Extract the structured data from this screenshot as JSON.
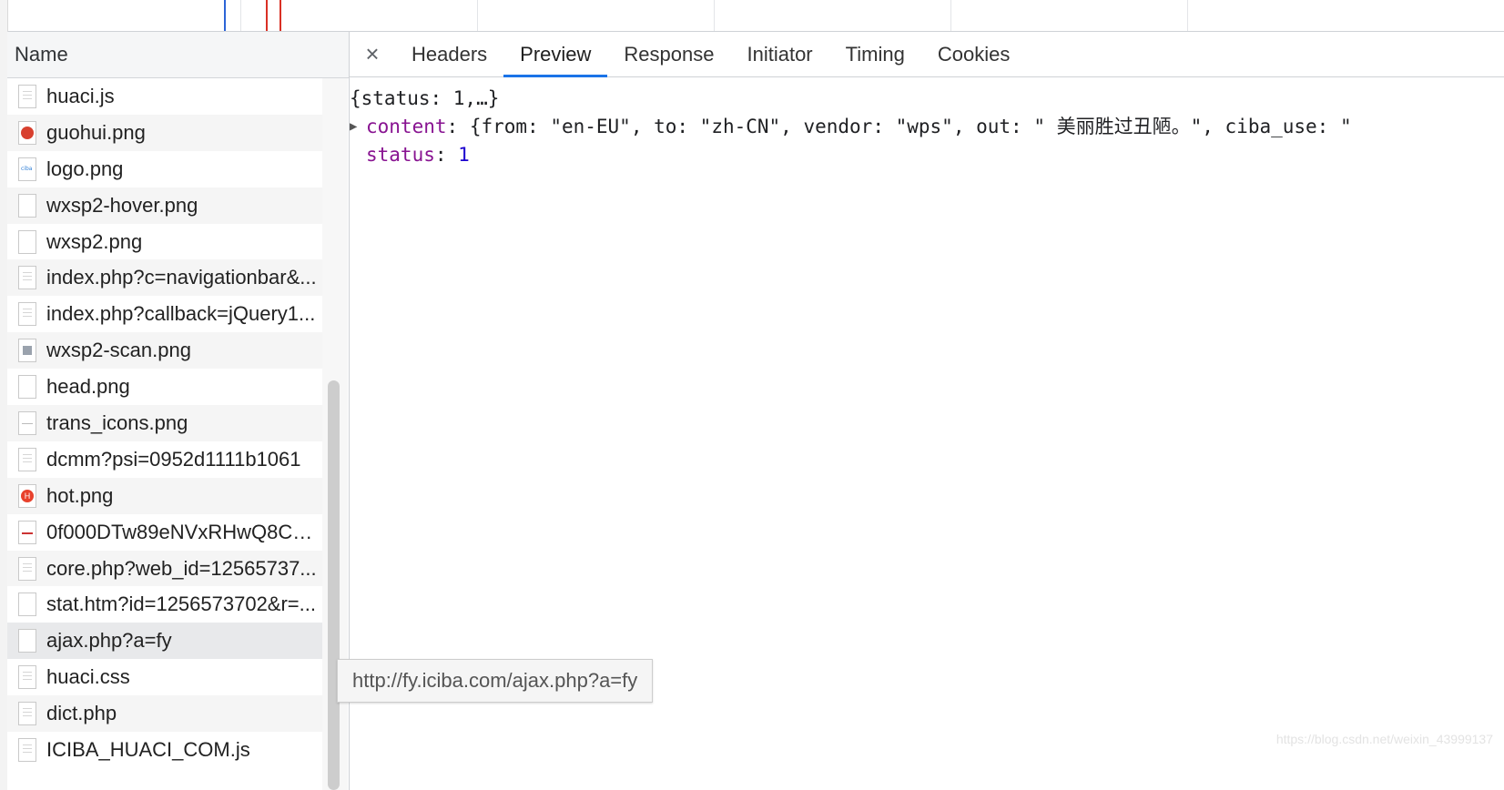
{
  "list": {
    "header": "Name",
    "rows": [
      {
        "name": "huaci.js",
        "icon": "document-icon"
      },
      {
        "name": "guohui.png",
        "icon": "image-icon"
      },
      {
        "name": "logo.png",
        "icon": "image-icon"
      },
      {
        "name": "wxsp2-hover.png",
        "icon": "image-icon"
      },
      {
        "name": "wxsp2.png",
        "icon": "image-icon"
      },
      {
        "name": "index.php?c=navigationbar&...",
        "icon": "document-icon"
      },
      {
        "name": "index.php?callback=jQuery1...",
        "icon": "document-icon"
      },
      {
        "name": "wxsp2-scan.png",
        "icon": "image-icon"
      },
      {
        "name": "head.png",
        "icon": "image-icon"
      },
      {
        "name": "trans_icons.png",
        "icon": "image-icon"
      },
      {
        "name": "dcmm?psi=0952d1111b1061",
        "icon": "document-icon"
      },
      {
        "name": "hot.png",
        "icon": "image-icon"
      },
      {
        "name": "0f000DTw89eNVxRHwQ8C2...",
        "icon": "image-icon"
      },
      {
        "name": "core.php?web_id=12565737...",
        "icon": "document-icon"
      },
      {
        "name": "stat.htm?id=1256573702&r=...",
        "icon": "document-icon"
      },
      {
        "name": "ajax.php?a=fy",
        "icon": "document-icon"
      },
      {
        "name": "huaci.css",
        "icon": "document-icon"
      },
      {
        "name": "dict.php",
        "icon": "document-icon"
      },
      {
        "name": "ICIBA_HUACI_COM.js",
        "icon": "document-icon"
      }
    ]
  },
  "tabs": {
    "close": "×",
    "items": [
      "Headers",
      "Preview",
      "Response",
      "Initiator",
      "Timing",
      "Cookies"
    ],
    "active": "Preview"
  },
  "preview": {
    "summary": "{status: 1,…}",
    "content_key": "content",
    "content_value": "{from: \"en-EU\", to: \"zh-CN\", vendor: \"wps\", out: \" 美丽胜过丑陋。\", ciba_use: \"",
    "status_key": "status",
    "status_value": "1"
  },
  "tooltip": "http://fy.iciba.com/ajax.php?a=fy",
  "watermark": "https://blog.csdn.net/weixin_43999137",
  "colors": {
    "accent": "#1a73e8",
    "key": "#881391",
    "number": "#1c00cf"
  }
}
